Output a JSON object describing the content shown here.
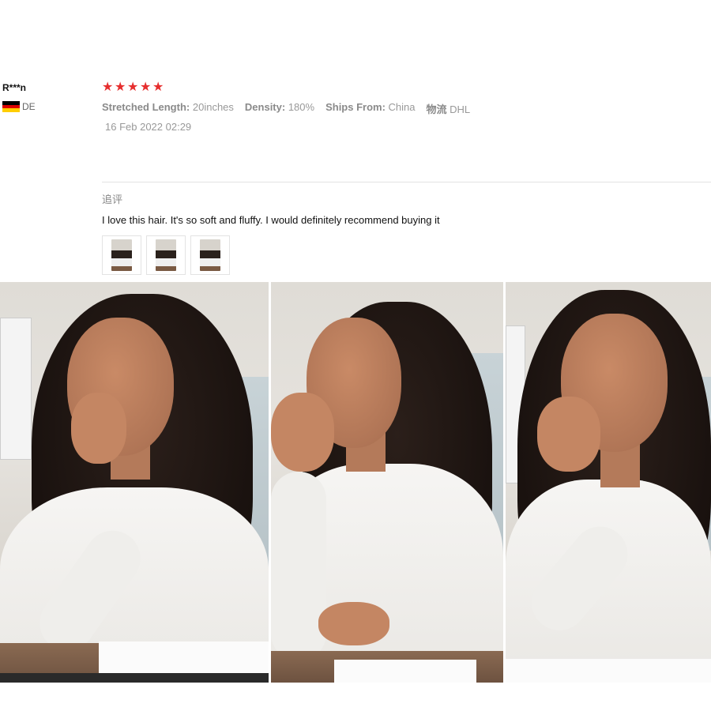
{
  "reviewer": {
    "name": "R***n",
    "country_code": "DE",
    "flag_icon": "germany-flag-icon"
  },
  "rating": {
    "stars": 5,
    "max": 5,
    "star_color": "#e62e2e"
  },
  "specs": [
    {
      "key": "Stretched Length:",
      "value": "20inches"
    },
    {
      "key": "Density:",
      "value": "180%"
    },
    {
      "key": "Ships From:",
      "value": "China"
    },
    {
      "key": "物流",
      "value": "DHL"
    }
  ],
  "date": "16 Feb 2022 02:29",
  "followup": {
    "label": "追评",
    "text": "I love this hair. It's so soft and fluffy. I would definitely recommend buying it"
  },
  "thumbnails": [
    {
      "name": "review-thumbnail-1"
    },
    {
      "name": "review-thumbnail-2"
    },
    {
      "name": "review-thumbnail-3"
    }
  ],
  "photos": [
    {
      "name": "review-photo-1"
    },
    {
      "name": "review-photo-2"
    },
    {
      "name": "review-photo-3"
    }
  ]
}
